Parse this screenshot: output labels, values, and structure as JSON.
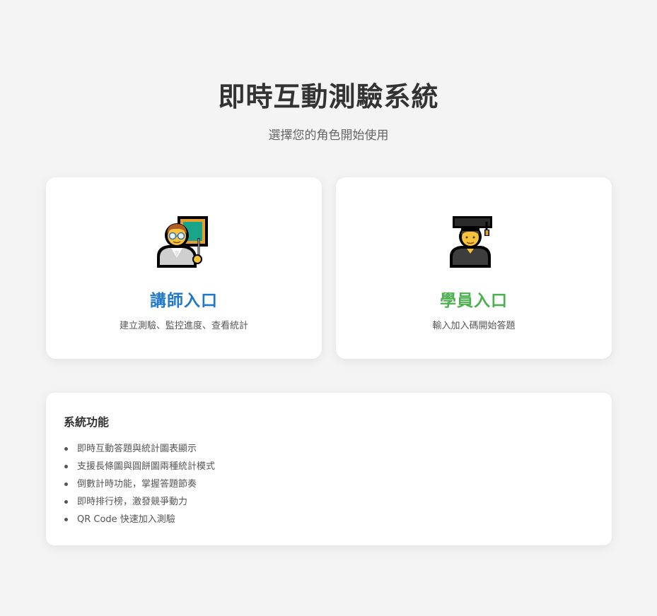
{
  "header": {
    "title": "即時互動測驗系統",
    "subtitle": "選擇您的角色開始使用"
  },
  "roles": [
    {
      "icon": "teacher-icon",
      "title": "講師入口",
      "description": "建立測驗、監控進度、查看統計",
      "accent": "#1f78c8"
    },
    {
      "icon": "student-icon",
      "title": "學員入口",
      "description": "輸入加入碼開始答題",
      "accent": "#4caf50"
    }
  ],
  "features": {
    "title": "系統功能",
    "items": [
      "即時互動答題與統計圖表顯示",
      "支援長條圖與圓餅圖兩種統計模式",
      "倒數計時功能，掌握答題節奏",
      "即時排行榜，激發競爭動力",
      "QR Code 快速加入測驗"
    ]
  }
}
